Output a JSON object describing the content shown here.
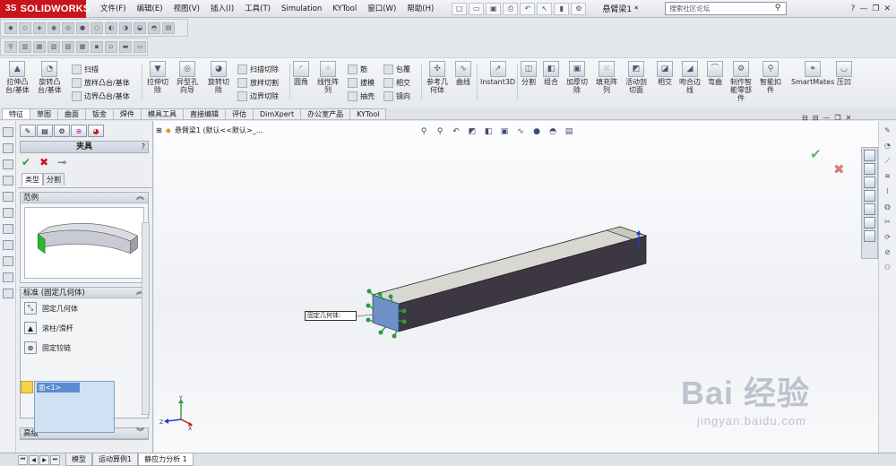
{
  "app": {
    "logo": "SOLIDWORKS",
    "doc_title": "悬臂梁1 *",
    "search_placeholder": "搜索社区论坛"
  },
  "menu": [
    "文件(F)",
    "编辑(E)",
    "视图(V)",
    "插入(I)",
    "工具(T)",
    "Simulation",
    "KYTool",
    "窗口(W)",
    "帮助(H)"
  ],
  "command_manager": {
    "big": [
      {
        "label": "拉伸凸\n台/基体"
      },
      {
        "label": "旋转凸\n台/基体"
      },
      {
        "label": "拉伸切\n除"
      },
      {
        "label": "异型孔\n向导"
      },
      {
        "label": "旋转切\n除"
      },
      {
        "label": "圆角"
      },
      {
        "label": "线性阵\n列"
      },
      {
        "label": "参考几\n何体"
      },
      {
        "label": "曲线"
      },
      {
        "label": "Instant3D"
      },
      {
        "label": "分割"
      },
      {
        "label": "组合"
      },
      {
        "label": "加厚切\n除"
      },
      {
        "label": "填充阵\n列"
      },
      {
        "label": "活动剖\n切面"
      },
      {
        "label": "相交"
      },
      {
        "label": "吻合边\n线"
      },
      {
        "label": "弯曲"
      },
      {
        "label": "制作智\n能零部\n件"
      },
      {
        "label": "智能扣\n件"
      },
      {
        "label": "SmartMates"
      },
      {
        "label": "压凹"
      }
    ],
    "small": [
      "扫描",
      "放样凸台/基体",
      "边界凸台/基体",
      "扫描切除",
      "放样切割",
      "边界切除",
      "筋",
      "拔模",
      "抽壳",
      "包覆",
      "相交",
      "镜向"
    ]
  },
  "tabs": [
    "特征",
    "草图",
    "曲面",
    "钣金",
    "焊件",
    "模具工具",
    "直接编辑",
    "评估",
    "DimXpert",
    "办公室产品",
    "KYTool"
  ],
  "property_manager": {
    "title": "夹具",
    "help": "?",
    "subtabs": [
      "类型",
      "分割"
    ],
    "example_header": "范例",
    "standard_header": "标准 (固定几何体)",
    "options": [
      "固定几何体",
      "滚柱/滑杆",
      "固定铰链"
    ],
    "selection": "面<1>",
    "advanced_header": "高级"
  },
  "graphics": {
    "tree_label": "悬臂梁1  (默认<<默认>_...",
    "callout": "固定几何体:"
  },
  "status_tabs": [
    "模型",
    "运动算例1",
    "静应力分析 1"
  ],
  "watermark": {
    "line1": "Bai 经验",
    "line2": "jingyan.baidu.com"
  },
  "colors": {
    "brand": "#c8151d",
    "fixture": "#2f9a3a",
    "beam_top": "#d7d5cf",
    "beam_side": "#3d3744",
    "selection": "#5b8bd0"
  }
}
